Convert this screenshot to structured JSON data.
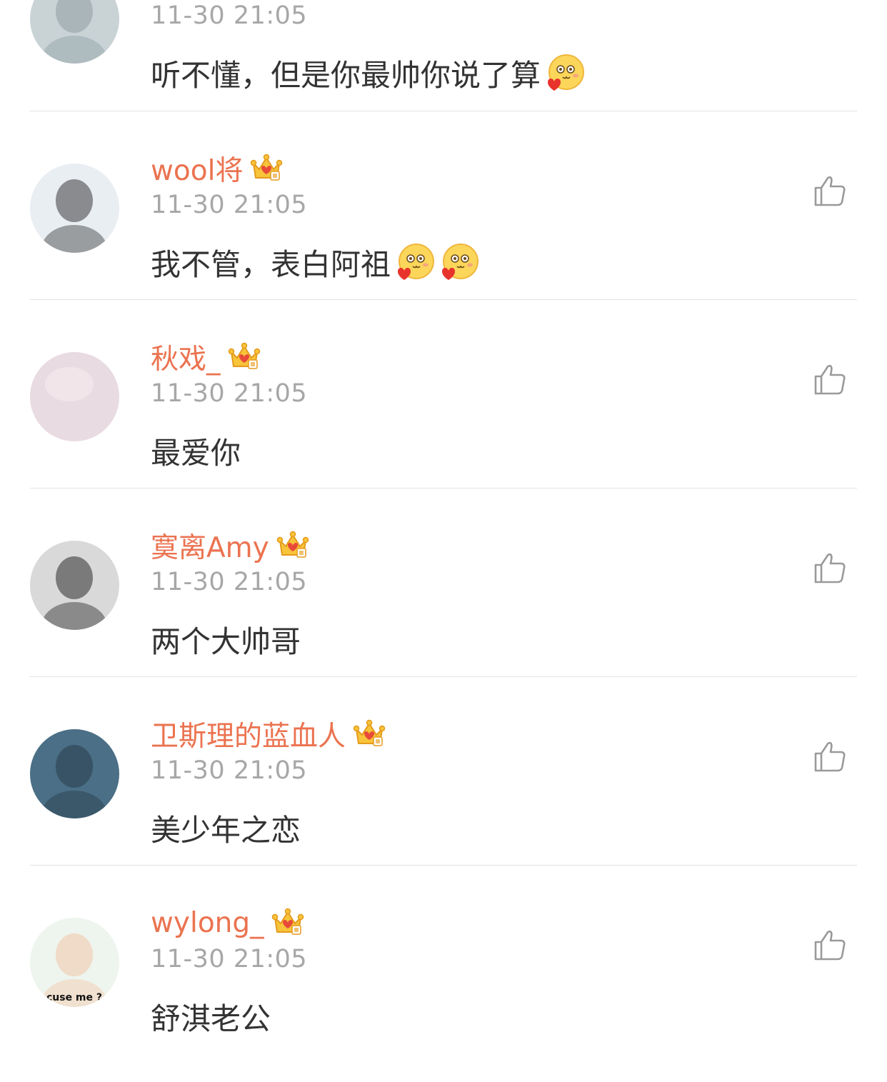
{
  "comments": [
    {
      "username": "",
      "timestamp": "11-30 21:05",
      "text": "听不懂，但是你最帅你说了算",
      "emoji_count": 1,
      "emoji": "smitten-face-icon",
      "show_like": false,
      "avatar_colors": [
        "#c9d3d6",
        "#8f9da3"
      ]
    },
    {
      "username": "wool将",
      "timestamp": "11-30 21:05",
      "text": "我不管，表白阿祖",
      "emoji_count": 2,
      "emoji": "smitten-face-icon",
      "show_like": true,
      "avatar_colors": [
        "#e9eef3",
        "#3a3a3a"
      ]
    },
    {
      "username": "秋戏_",
      "timestamp": "11-30 21:05",
      "text": "最爱你",
      "emoji_count": 0,
      "show_like": true,
      "avatar_colors": [
        "#e9dbe2",
        "#d5c3cd"
      ]
    },
    {
      "username": "寞离Amy",
      "timestamp": "11-30 21:05",
      "text": "两个大帅哥",
      "emoji_count": 0,
      "show_like": true,
      "avatar_colors": [
        "#d9d9d9",
        "#2b2b2b"
      ]
    },
    {
      "username": "卫斯理的蓝血人",
      "timestamp": "11-30 21:05",
      "text": "美少年之恋",
      "emoji_count": 0,
      "show_like": true,
      "avatar_colors": [
        "#4a6f86",
        "#2a3c4c"
      ]
    },
    {
      "username": "wylong_",
      "timestamp": "11-30 21:05",
      "text": "舒淇老公",
      "emoji_count": 0,
      "show_like": true,
      "avatar_colors": [
        "#eef4ee",
        "#f1c7a8"
      ],
      "avatar_caption": "cuse me ?"
    }
  ],
  "colors": {
    "username": "#eb7350",
    "timestamp": "#a7a7a7",
    "text": "#333333",
    "divider": "#e2e2e2",
    "like_icon": "#9a9a9a"
  },
  "icons": {
    "like": "thumbs-up-icon",
    "badge": "vip-crown-icon"
  }
}
